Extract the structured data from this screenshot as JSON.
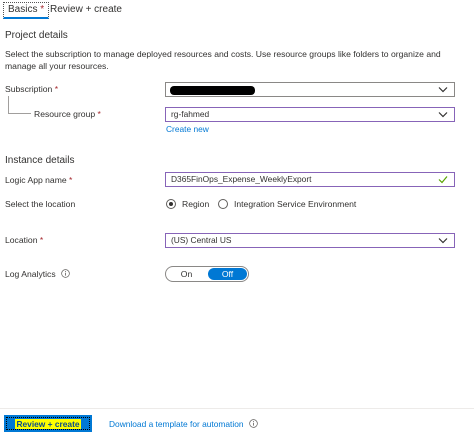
{
  "tabs": [
    {
      "label": "Basics",
      "required_mark": "*"
    },
    {
      "label": "Review + create"
    }
  ],
  "project_details": {
    "title": "Project details",
    "description": "Select the subscription to manage deployed resources and costs. Use resource groups like folders to organize and manage all your resources.",
    "subscription": {
      "label": "Subscription",
      "required_mark": "*"
    },
    "resource_group": {
      "label": "Resource group",
      "required_mark": "*",
      "value": "rg-fahmed"
    },
    "create_new": "Create new"
  },
  "instance_details": {
    "title": "Instance details",
    "logic_app_name": {
      "label": "Logic App name",
      "required_mark": "*",
      "value": "D365FinOps_Expense_WeeklyExport"
    },
    "select_location": {
      "label": "Select the location",
      "options": [
        "Region",
        "Integration Service Environment"
      ],
      "selected": "Region"
    },
    "location": {
      "label": "Location",
      "required_mark": "*",
      "value": "(US) Central US"
    },
    "log_analytics": {
      "label": "Log Analytics",
      "on_label": "On",
      "off_label": "Off",
      "selected": "Off"
    }
  },
  "footer": {
    "review_create": "Review + create",
    "download_template": "Download a template for automation"
  },
  "colors": {
    "accent": "#0078d4",
    "focus_border": "#8764b8",
    "required": "#a4262c",
    "valid_check": "#57a300",
    "highlight": "#ffff00"
  },
  "icons": {
    "dropdown": "chevron-down-icon",
    "valid": "checkmark-icon",
    "info": "info-icon"
  }
}
